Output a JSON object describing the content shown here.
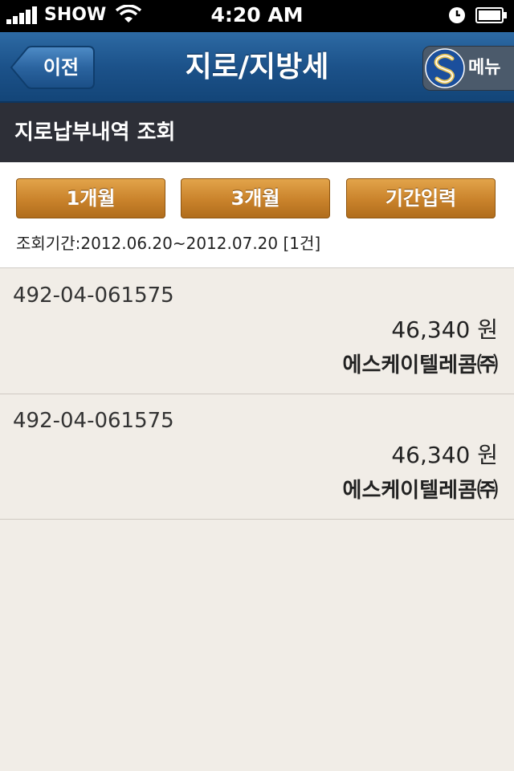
{
  "status_bar": {
    "carrier": "SHOW",
    "time": "4:20 AM"
  },
  "nav": {
    "back_label": "이전",
    "title": "지로/지방세",
    "menu_label": "메뉴"
  },
  "section": {
    "title": "지로납부내역 조회"
  },
  "filters": {
    "buttons": [
      "1개월",
      "3개월",
      "기간입력"
    ],
    "period_text": "조회기간:2012.06.20~2012.07.20 [1건]"
  },
  "records": [
    {
      "account": "492-04-061575",
      "amount": "46,340 원",
      "company": "에스케이텔레콤㈜"
    },
    {
      "account": "492-04-061575",
      "amount": "46,340 원",
      "company": "에스케이텔레콤㈜"
    }
  ],
  "colors": {
    "nav_blue": "#1c528a",
    "section_dark": "#2d2f37",
    "button_orange": "#c9822b",
    "list_bg": "#f1ede7"
  }
}
